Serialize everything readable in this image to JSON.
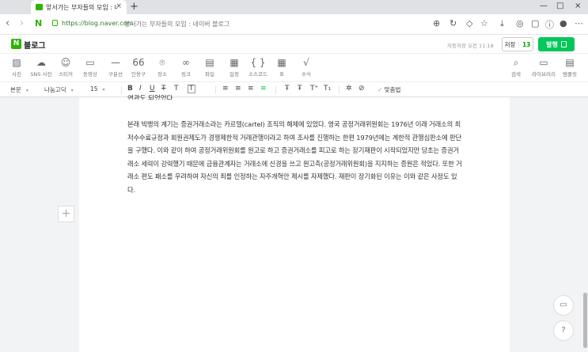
{
  "browser": {
    "tab_title": "앞서가는 부자들의 모임 : 네이버 블로그",
    "tab_close": "×",
    "new_tab": "+",
    "window_controls": [
      "—",
      "□",
      "×"
    ],
    "back": "‹",
    "forward": "›",
    "reload": "↻",
    "url": "https://blog.naver.com",
    "page_title": "앞서가는 부자들의 모임 : 네이버 블로그"
  },
  "header": {
    "logo_letter": "N",
    "title": "블로그",
    "saved_time": "자동저장 오전 11:18",
    "save_label": "저장",
    "save_count": "13",
    "publish_label": "발행"
  },
  "insert_toolbar": {
    "items": [
      {
        "label": "사진",
        "icon": "photo-icon"
      },
      {
        "label": "SNS 사진",
        "icon": "cloud-photo-icon"
      },
      {
        "label": "스티커",
        "icon": "sticker-icon"
      },
      {
        "label": "동영상",
        "icon": "video-icon"
      },
      {
        "label": "구분선",
        "icon": "divider-icon"
      },
      {
        "label": "인용구",
        "icon": "quote-icon"
      },
      {
        "label": "장소",
        "icon": "place-icon"
      },
      {
        "label": "링크",
        "icon": "link-icon"
      },
      {
        "label": "파일",
        "icon": "file-icon"
      },
      {
        "label": "일정",
        "icon": "calendar-icon"
      },
      {
        "label": "소스코드",
        "icon": "code-icon"
      },
      {
        "label": "표",
        "icon": "table-icon"
      },
      {
        "label": "수식",
        "icon": "formula-icon"
      }
    ],
    "right_items": [
      {
        "label": "검색",
        "icon": "search-icon"
      },
      {
        "label": "라이브러리",
        "icon": "library-icon"
      },
      {
        "label": "템플릿",
        "icon": "template-icon"
      }
    ]
  },
  "format_toolbar": {
    "style": "본문",
    "font": "나눔고딕",
    "size": "15",
    "spellcheck": "맞춤법"
  },
  "document": {
    "partial_line": "연관도 되었었다.",
    "paragraph": "본래 빅뱅의 계기는 증권거래소라는 카르텔(cartel) 조직의 해체에 있었다. 영국 공정거래위원회는 1976년 이래 거래소의 최저수수료규정과 회원권제도가 경쟁제한적 거래관행이라고 하여 조사를 진행하는 한편 1979년에는 계한적 관행심판소에 판단을 구했다. 이와 같이 하여 공정거래위원회를 원고로 하고 증권거래소를 피고로 하는 장기재판이 시작되었지만 당초는 증권거래소 세력이 강력했기 때문에 금융관계자는 거래소에 신경을 쓰고 원고측(공정거래위원회)을 지지하는 증원은 적었다. 또한 거래소 편도 패소를 우려하여 자신의 죄를 인정하는 자주개혁안 제시를 자제했다. 재판이 장기화된 이유는 이와 같은 사정도 있다.",
    "add_block": "+"
  },
  "side_buttons": {
    "monitor": "▭",
    "help": "?"
  }
}
